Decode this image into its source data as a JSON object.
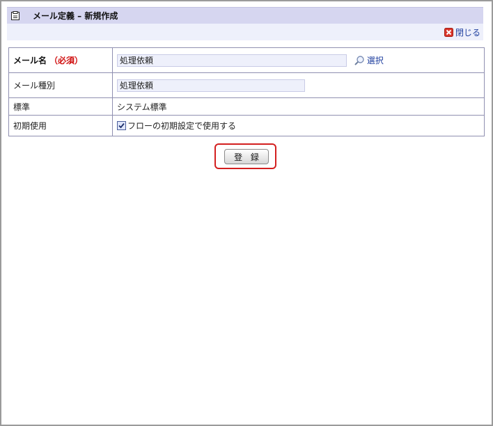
{
  "header": {
    "title": "メール定義 – 新規作成",
    "close_label": "閉じる"
  },
  "form": {
    "mail_name": {
      "label": "メール名",
      "required": "（必須）",
      "value": "処理依頼",
      "select_label": "選択"
    },
    "mail_type": {
      "label": "メール種別",
      "value": "処理依頼"
    },
    "standard": {
      "label": "標準",
      "value": "システム標準"
    },
    "initial_use": {
      "label": "初期使用",
      "checkbox_label": "フローの初期設定で使用する",
      "checked": true
    }
  },
  "actions": {
    "register_label": "登 録"
  },
  "colors": {
    "title_bar": "#d6d6f0",
    "sub_bar": "#eef0fb",
    "required": "#d01010",
    "link": "#1f3f9f",
    "highlight": "#d31f1f"
  }
}
